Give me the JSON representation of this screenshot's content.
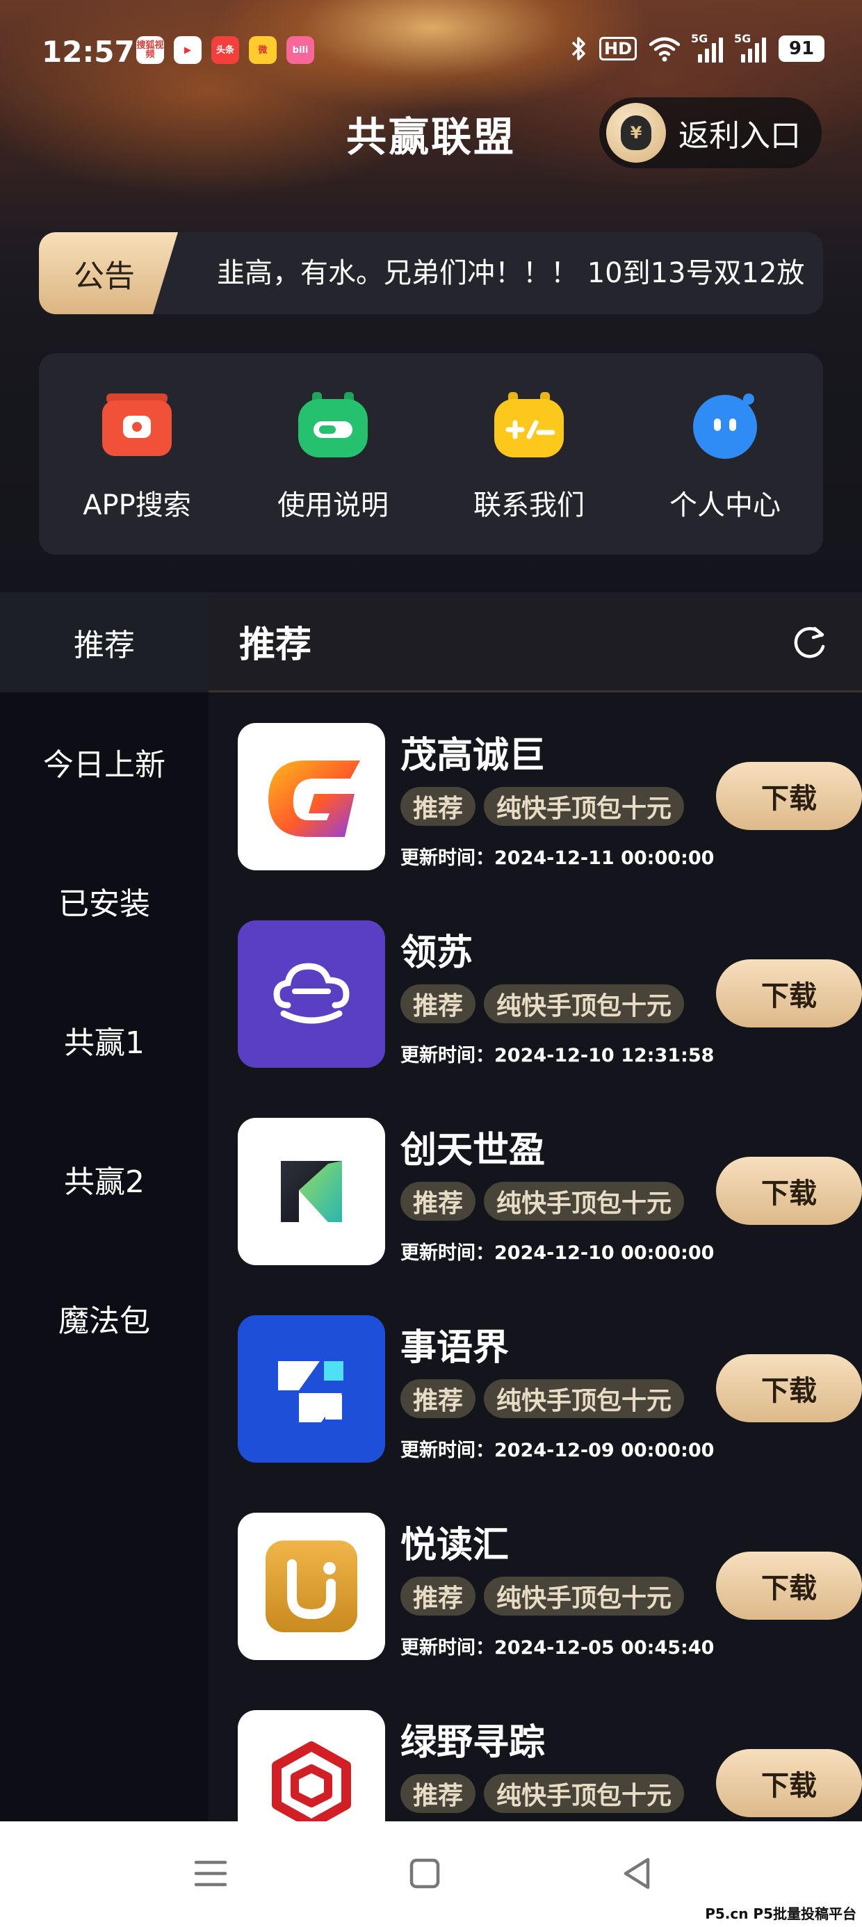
{
  "status_bar": {
    "time": "12:57",
    "apps": [
      {
        "icon": "sougou-video-app-icon",
        "label": "搜狐视频",
        "bg": "#ffffff",
        "fg": "#e03a3a"
      },
      {
        "icon": "video-play-app-icon",
        "label": "▶",
        "bg": "#ffffff",
        "fg": "#ff2d2d"
      },
      {
        "icon": "toutiao-app-icon",
        "label": "头条",
        "bg": "#f3403d",
        "fg": "#ffffff"
      },
      {
        "icon": "weibo-app-icon",
        "label": "微",
        "bg": "#ffcc2f",
        "fg": "#d8332b"
      },
      {
        "icon": "bilibili-app-icon",
        "label": "bili",
        "bg": "#f7679a",
        "fg": "#ffffff"
      }
    ],
    "hd": "HD",
    "signal_1": "5G",
    "signal_2": "5G",
    "battery": "91"
  },
  "header": {
    "title": "共赢联盟",
    "rebate_label": "返利入口",
    "rebate_coin": "¥"
  },
  "notice": {
    "tag": "公告",
    "text": "韭高，有水。兄弟们冲！！！ 10到13号双12放"
  },
  "quick_menu": [
    {
      "label": "APP搜索",
      "icon": "app-search-icon"
    },
    {
      "label": "使用说明",
      "icon": "instructions-icon"
    },
    {
      "label": "联系我们",
      "icon": "contact-us-icon"
    },
    {
      "label": "个人中心",
      "icon": "personal-center-icon"
    }
  ],
  "sidebar": {
    "items": [
      "推荐",
      "今日上新",
      "已安装",
      "共赢1",
      "共赢2",
      "魔法包"
    ],
    "active_index": 0
  },
  "main": {
    "heading": "推荐",
    "apps": [
      {
        "name": "茂高诚巨",
        "tag1": "推荐",
        "tag2": "纯快手顶包十元",
        "time": "更新时间：2024-12-11 00:00:00",
        "button": "下载",
        "logo": "maogao-logo-icon"
      },
      {
        "name": "领苏",
        "tag1": "推荐",
        "tag2": "纯快手顶包十元",
        "time": "更新时间：2024-12-10 12:31:58",
        "button": "下载",
        "logo": "lingsu-cloud-logo-icon"
      },
      {
        "name": "创天世盈",
        "tag1": "推荐",
        "tag2": "纯快手顶包十元",
        "time": "更新时间：2024-12-10 00:00:00",
        "button": "下载",
        "logo": "chuangtian-logo-icon"
      },
      {
        "name": "事语界",
        "tag1": "推荐",
        "tag2": "纯快手顶包十元",
        "time": "更新时间：2024-12-09 00:00:00",
        "button": "下载",
        "logo": "shiyujie-logo-icon"
      },
      {
        "name": "悦读汇",
        "tag1": "推荐",
        "tag2": "纯快手顶包十元",
        "time": "更新时间：2024-12-05 00:45:40",
        "button": "下载",
        "logo": "yueduhui-logo-icon"
      },
      {
        "name": "绿野寻踪",
        "tag1": "推荐",
        "tag2": "纯快手顶包十元",
        "time": "",
        "button": "下载",
        "logo": "lvye-logo-icon"
      }
    ]
  },
  "watermark": "P5.cn P5批量投稿平台",
  "colors": {
    "accent_gold": "#e6c58f",
    "panel": "#25262d",
    "tag_bg": "#48443a"
  }
}
